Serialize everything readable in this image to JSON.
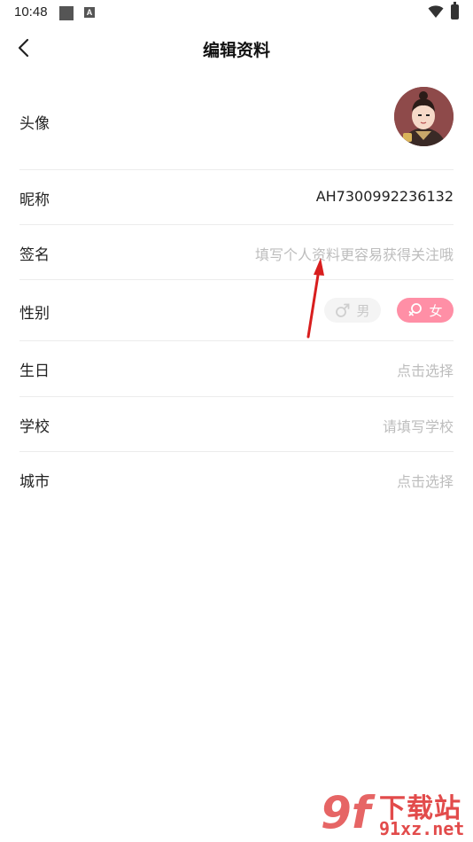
{
  "status_bar": {
    "time": "10:48",
    "notif_badge": "A"
  },
  "header": {
    "title": "编辑资料",
    "back_icon": "chevron-left-icon"
  },
  "rows": {
    "avatar": {
      "label": "头像"
    },
    "nickname": {
      "label": "昵称",
      "value": "AH7300992236132"
    },
    "signature": {
      "label": "签名",
      "placeholder": "填写个人资料更容易获得关注哦"
    },
    "gender": {
      "label": "性别",
      "male": "男",
      "female": "女",
      "selected": "女"
    },
    "birthday": {
      "label": "生日",
      "placeholder": "点击选择"
    },
    "school": {
      "label": "学校",
      "placeholder": "请填写学校"
    },
    "city": {
      "label": "城市",
      "placeholder": "点击选择"
    }
  },
  "colors": {
    "accent_pink": "#ff8fa6",
    "arrow_red": "#d81e1e",
    "divider": "#ececec",
    "placeholder": "#bdbdbd"
  },
  "watermark": {
    "logo": "9f",
    "title": "下载站",
    "domain": "91xz.net"
  }
}
